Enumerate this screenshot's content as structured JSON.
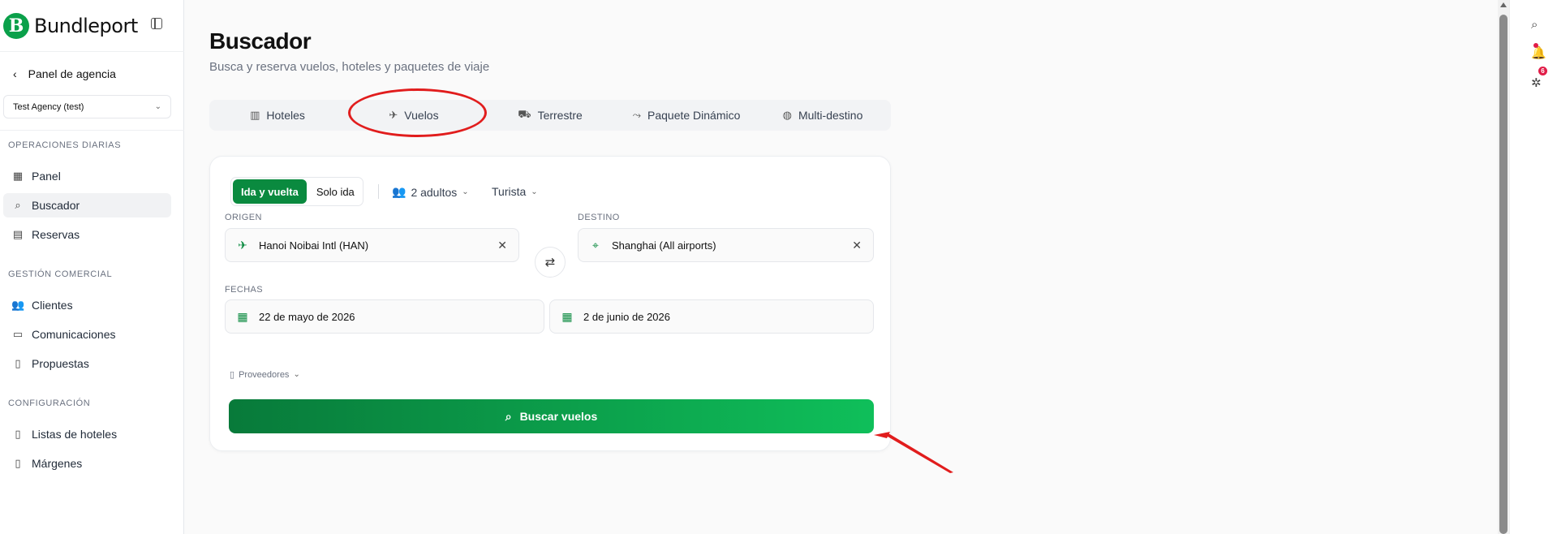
{
  "sidebar": {
    "brand": "Bundleport",
    "back_label": "Panel de agencia",
    "agency": "Test Agency (test)",
    "sections": [
      {
        "title": "OPERACIONES DIARIAS",
        "items": [
          {
            "label": "Panel",
            "icon": "dashboard-icon"
          },
          {
            "label": "Buscador",
            "icon": "search-icon",
            "active": true
          },
          {
            "label": "Reservas",
            "icon": "calendar-icon"
          }
        ]
      },
      {
        "title": "GESTIÓN COMERCIAL",
        "items": [
          {
            "label": "Clientes",
            "icon": "users-icon"
          },
          {
            "label": "Comunicaciones",
            "icon": "chat-icon"
          },
          {
            "label": "Propuestas",
            "icon": "document-icon"
          }
        ]
      },
      {
        "title": "CONFIGURACIÓN",
        "items": [
          {
            "label": "Listas de hoteles",
            "icon": "bookmark-list-icon"
          },
          {
            "label": "Márgenes",
            "icon": "document-icon"
          }
        ]
      }
    ]
  },
  "header": {
    "title": "Buscador",
    "subtitle": "Busca y reserva vuelos, hoteles y paquetes de viaje"
  },
  "tabs": [
    {
      "label": "Hoteles",
      "icon": "building-icon"
    },
    {
      "label": "Vuelos",
      "icon": "plane-icon",
      "active": true
    },
    {
      "label": "Terrestre",
      "icon": "bus-icon"
    },
    {
      "label": "Paquete Dinámico",
      "icon": "route-icon"
    },
    {
      "label": "Multi-destino",
      "icon": "globe-icon"
    }
  ],
  "search": {
    "trip_types": [
      "Ida y vuelta",
      "Solo ida"
    ],
    "selected_trip_type": "Ida y vuelta",
    "passengers": "2 adultos",
    "cabin": "Turista",
    "origin_label": "ORIGEN",
    "origin_value": "Hanoi Noibai Intl (HAN)",
    "destination_label": "DESTINO",
    "destination_value": "Shanghai (All airports)",
    "dates_label": "FECHAS",
    "departure_date": "22 de mayo de 2026",
    "return_date": "2 de junio de 2026",
    "providers_label": "Proveedores",
    "submit_label": "Buscar vuelos"
  },
  "right_rail": {
    "notification_count": "6"
  },
  "colors": {
    "accent": "#0a8a3f",
    "button_gradient_start": "#087a3a",
    "button_gradient_end": "#0fbf5a",
    "annotation": "#e11d1d"
  }
}
